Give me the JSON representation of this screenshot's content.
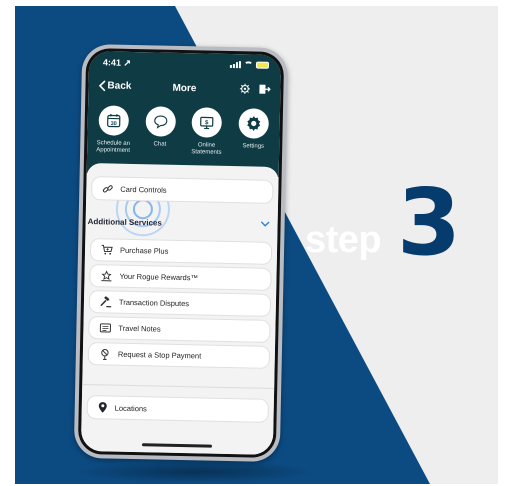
{
  "status": {
    "time": "4:41 ↗"
  },
  "nav": {
    "back_label": "Back",
    "title": "More"
  },
  "quick_actions": [
    {
      "label": "Schedule an Appointment",
      "icon": "calendar-icon"
    },
    {
      "label": "Chat",
      "icon": "chat-bubble-icon"
    },
    {
      "label": "Online Statements",
      "icon": "statement-icon"
    },
    {
      "label": "Settings",
      "icon": "gear-icon"
    }
  ],
  "card_controls": {
    "label": "Card Controls",
    "icon": "link-icon"
  },
  "additional_services": {
    "title": "Additional Services",
    "items": [
      {
        "label": "Purchase Plus",
        "icon": "cart-icon"
      },
      {
        "label": "Your Rogue Rewards™",
        "icon": "rewards-icon"
      },
      {
        "label": "Transaction Disputes",
        "icon": "gavel-icon"
      },
      {
        "label": "Travel Notes",
        "icon": "notes-icon"
      },
      {
        "label": "Request a Stop Payment",
        "icon": "stop-icon"
      }
    ]
  },
  "locations": {
    "label": "Locations",
    "icon": "map-pin-icon"
  },
  "step": {
    "word": "step",
    "number": "3"
  },
  "colors": {
    "navy": "#0c4b82",
    "dark_teal": "#0f3b45",
    "step_number": "#063b6e",
    "accent_blue": "#2f80d1"
  }
}
